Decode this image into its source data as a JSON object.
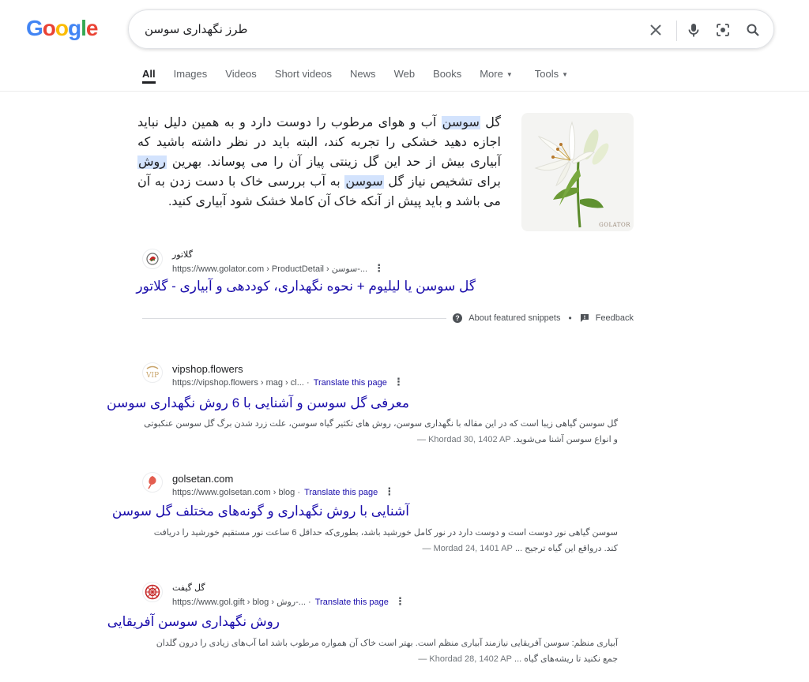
{
  "logo": {
    "letters": [
      "G",
      "o",
      "o",
      "g",
      "l",
      "e"
    ]
  },
  "search": {
    "query": "طرز نگهداری سوسن"
  },
  "tabs": [
    {
      "label": "All"
    },
    {
      "label": "Images"
    },
    {
      "label": "Videos"
    },
    {
      "label": "Short videos"
    },
    {
      "label": "News"
    },
    {
      "label": "Web"
    },
    {
      "label": "Books"
    },
    {
      "label": "More"
    },
    {
      "label": "Tools"
    }
  ],
  "featured": {
    "text_parts": [
      "گل ",
      "سوسن",
      " آب و هوای مرطوب را دوست دارد و به همین دلیل نباید اجازه دهید خشکی را تجربه کند، البته باید در نظر داشته باشید که آبیاری بیش از حد این گل زینتی پیاز آن را می پوساند. بهرین ",
      "روش",
      " برای تشخیص نیاز گل ",
      "سوسن",
      " به آب بررسی خاک با دست زدن به آن می باشد و باید پیش از آنکه خاک آن کاملا خشک شود آبیاری کنید."
    ],
    "image_watermark": "GOLATOR",
    "site_name": "گلاتور",
    "site_url": "https://www.golator.com › ProductDetail › سوسن-...",
    "title": "گل سوسن یا لیلیوم + نحوه نگهداری، کوددهی و آبیاری - گلاتور",
    "about_label": "About featured snippets",
    "feedback_label": "Feedback",
    "separator": "•"
  },
  "results": [
    {
      "site_name": "vipshop.flowers",
      "site_url": "https://vipshop.flowers › mag › cl... ·",
      "translate": "Translate this page",
      "title": "معرفی گل سوسن و آشنایی با 6 روش نگهداری سوسن",
      "date": "Khordad 30, 1402 AP —",
      "desc": "گل سوسن گیاهی زیبا است که در این مقاله با نگهداری سوسن، روش های تکثیر گیاه سوسن، علت زرد شدن برگ گل سوسن عنکبوتی و انواع سوسن آشنا می‌شوید."
    },
    {
      "site_name": "golsetan.com",
      "site_url": "https://www.golsetan.com › blog ·",
      "translate": "Translate this page",
      "title": "آشنایی با روش نگهداری و گونه‌های مختلف گل سوسن",
      "date": "Mordad 24, 1401 AP —",
      "desc": "سوسن گیاهی نور دوست است و دوست دارد در نور کامل خورشید باشد، بطوری‌که حداقل 6 ساعت نور مستقیم خورشید را دریافت کند. درواقع این گیاه ترجیح ..."
    },
    {
      "site_name": "گل گیفت",
      "site_url": "https://www.gol.gift › blog › روش-... ·",
      "translate": "Translate this page",
      "title": "روش نگهداری سوسن آفریقایی",
      "date": "Khordad 28, 1402 AP —",
      "desc": "آبیاری منظم: سوسن آفریقایی نیازمند آبیاری منظم است. بهتر است خاک آن همواره مرطوب باشد اما آب‌های زیادی را درون گلدان جمع نکنید تا ریشه‌های گیاه ..."
    }
  ],
  "colors": {
    "link": "#1a0dab",
    "highlight": "#d3e3fd",
    "text": "#202124",
    "muted": "#4d5156"
  }
}
